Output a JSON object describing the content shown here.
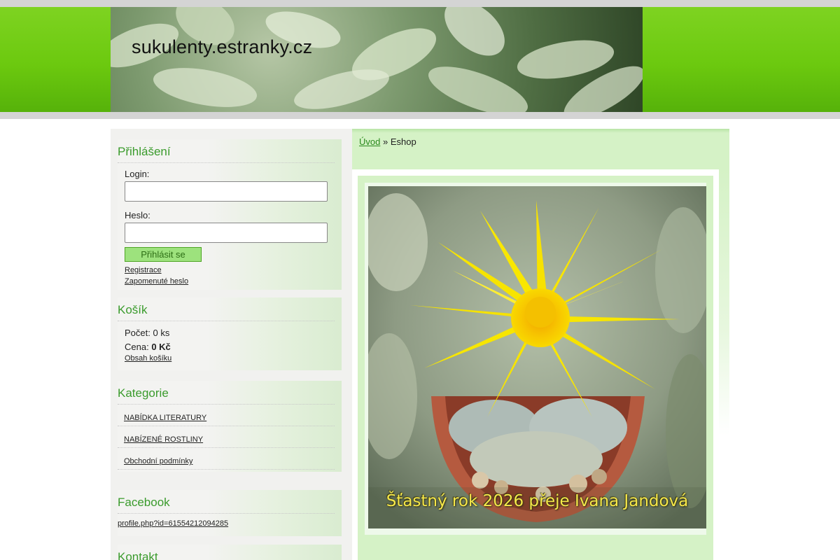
{
  "site": {
    "title": "sukulenty.estranky.cz"
  },
  "login": {
    "heading": "Přihlášení",
    "login_label": "Login:",
    "login_value": "",
    "password_label": "Heslo:",
    "password_value": "",
    "submit_label": "Přihlásit se",
    "register_link": "Registrace",
    "forgot_link": "Zapomenuté heslo"
  },
  "cart": {
    "heading": "Košík",
    "count_label": "Počet:",
    "count_value": "0 ks",
    "price_label": "Cena:",
    "price_value": "0 Kč",
    "contents_link": "Obsah košíku"
  },
  "categories": {
    "heading": "Kategorie",
    "items": [
      {
        "label": "NABÍDKA LITERATURY"
      },
      {
        "label": "NABÍZENÉ ROSTLINY"
      },
      {
        "label": "Obchodní podmínky"
      }
    ]
  },
  "facebook": {
    "heading": "Facebook",
    "link": "profile.php?id=61554212094285"
  },
  "contact": {
    "heading": "Kontakt"
  },
  "breadcrumb": {
    "home": "Úvod",
    "separator": "»",
    "current": "Eshop"
  },
  "content": {
    "image_caption": "Šťastný rok 2026 přeje Ivana Jandová"
  },
  "colors": {
    "header_green": "#6cc90f",
    "heading_green": "#3a9b2c",
    "panel_green": "#d5f2c6",
    "button_green": "#9de27d"
  }
}
